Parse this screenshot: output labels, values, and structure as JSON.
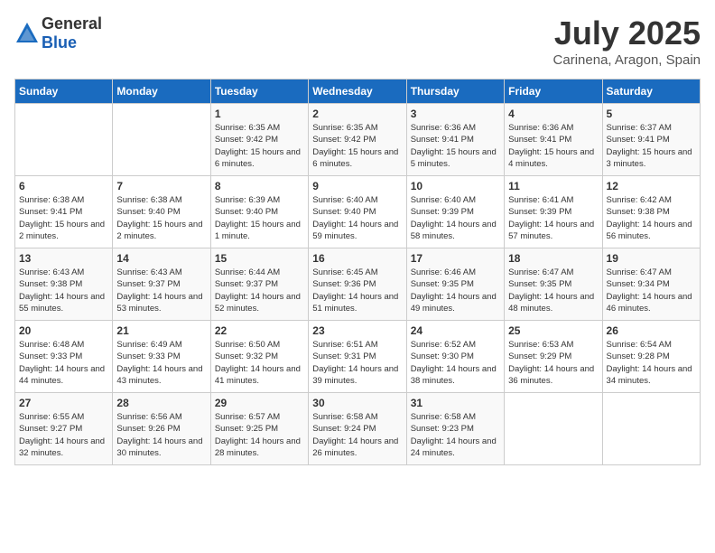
{
  "header": {
    "logo_general": "General",
    "logo_blue": "Blue",
    "month": "July 2025",
    "location": "Carinena, Aragon, Spain"
  },
  "weekdays": [
    "Sunday",
    "Monday",
    "Tuesday",
    "Wednesday",
    "Thursday",
    "Friday",
    "Saturday"
  ],
  "weeks": [
    [
      {
        "day": "",
        "info": ""
      },
      {
        "day": "",
        "info": ""
      },
      {
        "day": "1",
        "info": "Sunrise: 6:35 AM\nSunset: 9:42 PM\nDaylight: 15 hours and 6 minutes."
      },
      {
        "day": "2",
        "info": "Sunrise: 6:35 AM\nSunset: 9:42 PM\nDaylight: 15 hours and 6 minutes."
      },
      {
        "day": "3",
        "info": "Sunrise: 6:36 AM\nSunset: 9:41 PM\nDaylight: 15 hours and 5 minutes."
      },
      {
        "day": "4",
        "info": "Sunrise: 6:36 AM\nSunset: 9:41 PM\nDaylight: 15 hours and 4 minutes."
      },
      {
        "day": "5",
        "info": "Sunrise: 6:37 AM\nSunset: 9:41 PM\nDaylight: 15 hours and 3 minutes."
      }
    ],
    [
      {
        "day": "6",
        "info": "Sunrise: 6:38 AM\nSunset: 9:41 PM\nDaylight: 15 hours and 2 minutes."
      },
      {
        "day": "7",
        "info": "Sunrise: 6:38 AM\nSunset: 9:40 PM\nDaylight: 15 hours and 2 minutes."
      },
      {
        "day": "8",
        "info": "Sunrise: 6:39 AM\nSunset: 9:40 PM\nDaylight: 15 hours and 1 minute."
      },
      {
        "day": "9",
        "info": "Sunrise: 6:40 AM\nSunset: 9:40 PM\nDaylight: 14 hours and 59 minutes."
      },
      {
        "day": "10",
        "info": "Sunrise: 6:40 AM\nSunset: 9:39 PM\nDaylight: 14 hours and 58 minutes."
      },
      {
        "day": "11",
        "info": "Sunrise: 6:41 AM\nSunset: 9:39 PM\nDaylight: 14 hours and 57 minutes."
      },
      {
        "day": "12",
        "info": "Sunrise: 6:42 AM\nSunset: 9:38 PM\nDaylight: 14 hours and 56 minutes."
      }
    ],
    [
      {
        "day": "13",
        "info": "Sunrise: 6:43 AM\nSunset: 9:38 PM\nDaylight: 14 hours and 55 minutes."
      },
      {
        "day": "14",
        "info": "Sunrise: 6:43 AM\nSunset: 9:37 PM\nDaylight: 14 hours and 53 minutes."
      },
      {
        "day": "15",
        "info": "Sunrise: 6:44 AM\nSunset: 9:37 PM\nDaylight: 14 hours and 52 minutes."
      },
      {
        "day": "16",
        "info": "Sunrise: 6:45 AM\nSunset: 9:36 PM\nDaylight: 14 hours and 51 minutes."
      },
      {
        "day": "17",
        "info": "Sunrise: 6:46 AM\nSunset: 9:35 PM\nDaylight: 14 hours and 49 minutes."
      },
      {
        "day": "18",
        "info": "Sunrise: 6:47 AM\nSunset: 9:35 PM\nDaylight: 14 hours and 48 minutes."
      },
      {
        "day": "19",
        "info": "Sunrise: 6:47 AM\nSunset: 9:34 PM\nDaylight: 14 hours and 46 minutes."
      }
    ],
    [
      {
        "day": "20",
        "info": "Sunrise: 6:48 AM\nSunset: 9:33 PM\nDaylight: 14 hours and 44 minutes."
      },
      {
        "day": "21",
        "info": "Sunrise: 6:49 AM\nSunset: 9:33 PM\nDaylight: 14 hours and 43 minutes."
      },
      {
        "day": "22",
        "info": "Sunrise: 6:50 AM\nSunset: 9:32 PM\nDaylight: 14 hours and 41 minutes."
      },
      {
        "day": "23",
        "info": "Sunrise: 6:51 AM\nSunset: 9:31 PM\nDaylight: 14 hours and 39 minutes."
      },
      {
        "day": "24",
        "info": "Sunrise: 6:52 AM\nSunset: 9:30 PM\nDaylight: 14 hours and 38 minutes."
      },
      {
        "day": "25",
        "info": "Sunrise: 6:53 AM\nSunset: 9:29 PM\nDaylight: 14 hours and 36 minutes."
      },
      {
        "day": "26",
        "info": "Sunrise: 6:54 AM\nSunset: 9:28 PM\nDaylight: 14 hours and 34 minutes."
      }
    ],
    [
      {
        "day": "27",
        "info": "Sunrise: 6:55 AM\nSunset: 9:27 PM\nDaylight: 14 hours and 32 minutes."
      },
      {
        "day": "28",
        "info": "Sunrise: 6:56 AM\nSunset: 9:26 PM\nDaylight: 14 hours and 30 minutes."
      },
      {
        "day": "29",
        "info": "Sunrise: 6:57 AM\nSunset: 9:25 PM\nDaylight: 14 hours and 28 minutes."
      },
      {
        "day": "30",
        "info": "Sunrise: 6:58 AM\nSunset: 9:24 PM\nDaylight: 14 hours and 26 minutes."
      },
      {
        "day": "31",
        "info": "Sunrise: 6:58 AM\nSunset: 9:23 PM\nDaylight: 14 hours and 24 minutes."
      },
      {
        "day": "",
        "info": ""
      },
      {
        "day": "",
        "info": ""
      }
    ]
  ]
}
